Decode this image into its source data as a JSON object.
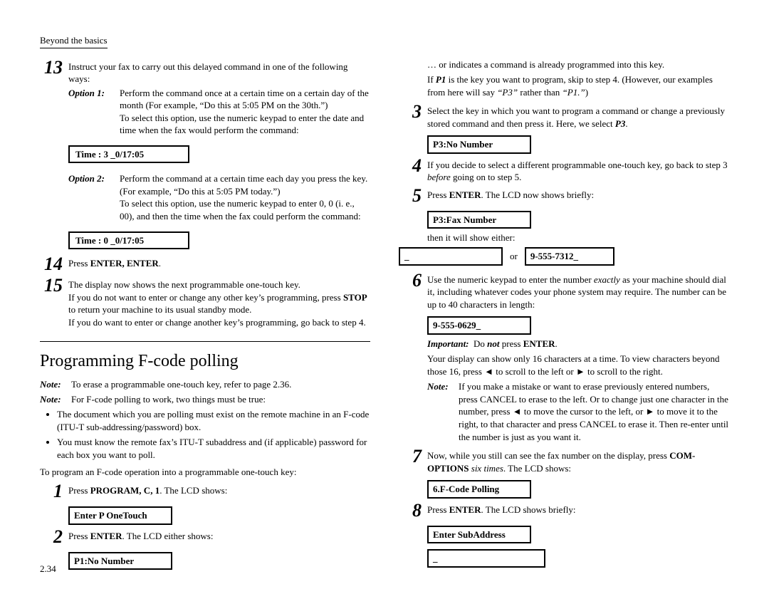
{
  "header": "Beyond the basics",
  "pagenum": "2.34",
  "left": {
    "s13": {
      "num": "13",
      "body": "Instruct your fax to carry out this delayed command in one of the following ways:",
      "opt1": {
        "label": "Option 1:",
        "t1": "Perform the command once at a certain time on a certain day of the month (For example, “Do this at 5:05 PM on the 30th.”)",
        "t2": "To select this option, use the numeric keypad to enter the date and time when the fax would perform the command:",
        "lcd": "Time :  3 _0/17:05"
      },
      "opt2": {
        "label": "Option 2:",
        "t1": "Perform the command at a certain time each day you press the key. (For example, “Do this at 5:05 PM today.”)",
        "t2": "To select this option, use the numeric keypad to enter 0, 0 (i. e., 00), and then the time when the fax could perform the command:",
        "lcd": "Time :  0 _0/17:05"
      }
    },
    "s14": {
      "num": "14",
      "body": "Press ",
      "k1": "ENTER, ENTER",
      "body2": "."
    },
    "s15": {
      "num": "15",
      "l1": "The display now shows the next programmable one-touch key.",
      "l2a": "If you do not want to enter or change any other key’s programming, press ",
      "l2k": "STOP",
      "l2b": " to return your machine to its usual standby mode.",
      "l3": "If you do want to enter or change another key’s programming, go back to step 4."
    },
    "h2a": "Programming ",
    "h2b": "F",
    "h2c": "-code polling",
    "n1": {
      "lbl": "Note:",
      "txt": "To erase a programmable one-touch key, refer to page 2.36."
    },
    "n2": {
      "lbl": "Note:",
      "txt": "For F-code polling to work, two things must be true:"
    },
    "b1": "The document which you are polling must exist on the remote machine in an F-code (ITU-T sub-addressing/password) box.",
    "b2": "You must know the remote fax’s ITU-T subaddress and (if applicable) password for each box you want to poll.",
    "para": "To program an F-code operation into a programmable one-touch key:",
    "p1": {
      "num": "1",
      "a": "Press ",
      "k": "PROGRAM, C, 1",
      "b": ". The ",
      "c": "LCD",
      "d": " shows:",
      "lcd": "Enter P OneTouch"
    },
    "p2": {
      "num": "2",
      "a": "Press ",
      "k": "ENTER",
      "b": ". The ",
      "c": "LCD",
      "d": " either shows:",
      "lcd": "P1:No Number"
    }
  },
  "right": {
    "line1": "… or indicates a command is already programmed into this key.",
    "line2a": "If ",
    "line2k": "P1",
    "line2b": " is the key you want to program, skip to step 4. (However, our examples from here will say ",
    "line2c": "“P3”",
    "line2d": " rather than ",
    "line2e": "“P1.”",
    "line2f": ")",
    "s3": {
      "num": "3",
      "a": "Select the key in which you want to program a command or change a previously stored command and then press it. Here, we select ",
      "k": "P3",
      "b": ".",
      "lcd": "P3:No Number"
    },
    "s4": {
      "num": "4",
      "a": "If you decide to select a different programmable one-touch key, go back to step 3 ",
      "i": "before",
      "b": " going on to step 5."
    },
    "s5": {
      "num": "5",
      "a": "Press ",
      "k": "ENTER",
      "b": ". The ",
      "c": "LCD",
      "d": " now shows briefly:",
      "lcd": "P3:Fax Number",
      "then": "then it will show either:",
      "lcdA": "_",
      "or": "or",
      "lcdB": "9-555-7312_"
    },
    "s6": {
      "num": "6",
      "a": "Use the numeric keypad to enter the number ",
      "i": "exactly",
      "b": " as your machine should dial it, including whatever codes your phone system may require. The number can be up to 40 characters in length:",
      "lcd": "9-555-0629_",
      "imp": {
        "lbl": "Important:",
        "a": "Do ",
        "i": "not",
        "b": " press ",
        "k": "ENTER",
        "c": "."
      },
      "p2a": "Your display can show only 16 characters at a time. To view characters beyond those 16, press ◄ to scroll to the left or ► to scroll to the right.",
      "note": {
        "lbl": "Note:",
        "txt": "If you make a mistake or want to erase previously entered numbers, press CANCEL to erase to the left. Or to change just one character in the number, press ◄ to move the cursor to the left, or ► to move it to the right, to that character and press CANCEL to erase it. Then re-enter until the number is just as you want it."
      }
    },
    "s7": {
      "num": "7",
      "a": "Now, while you still can see the fax number on the display, press ",
      "k": "COM-OPTIONS",
      "i": " six times",
      "b": ". The ",
      "c": "LCD",
      "d": " shows:",
      "lcd": "6.F-Code Polling"
    },
    "s8": {
      "num": "8",
      "a": "Press ",
      "k": "ENTER",
      "b": ". The ",
      "c": "LCD",
      "d": " shows briefly:",
      "lcd": "Enter SubAddress",
      "lcd2": "_"
    }
  }
}
